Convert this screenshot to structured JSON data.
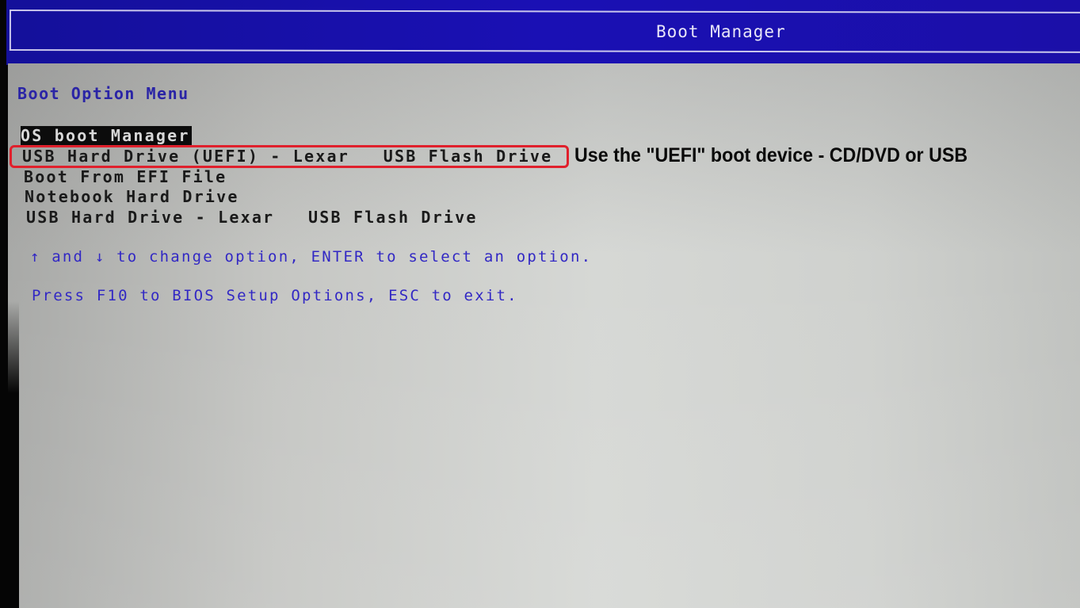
{
  "header": {
    "title": "Boot Manager"
  },
  "menu": {
    "title": "Boot Option Menu",
    "items": [
      {
        "label": "OS boot Manager",
        "selected": true
      },
      {
        "label": "USB Hard Drive (UEFI) - Lexar   USB Flash Drive",
        "selected": false
      },
      {
        "label": "Boot From EFI File",
        "selected": false
      },
      {
        "label": "Notebook Hard Drive",
        "selected": false
      },
      {
        "label": "USB Hard Drive - Lexar   USB Flash Drive",
        "selected": false
      }
    ]
  },
  "hints": {
    "navigation": "↑ and ↓ to change option, ENTER to select an option.",
    "setup": "Press F10 to BIOS Setup Options, ESC to exit."
  },
  "annotation": {
    "text": "Use the \"UEFI\" boot device - CD/DVD or USB",
    "highlight_color": "#e0202c"
  },
  "colors": {
    "header_bg": "#1a10b4",
    "header_text": "#e8e6f8",
    "menu_title": "#2a24a6",
    "hint_text": "#3228c4",
    "panel_bg": "#d0d2cf",
    "selected_bg": "#0c0c0c"
  }
}
